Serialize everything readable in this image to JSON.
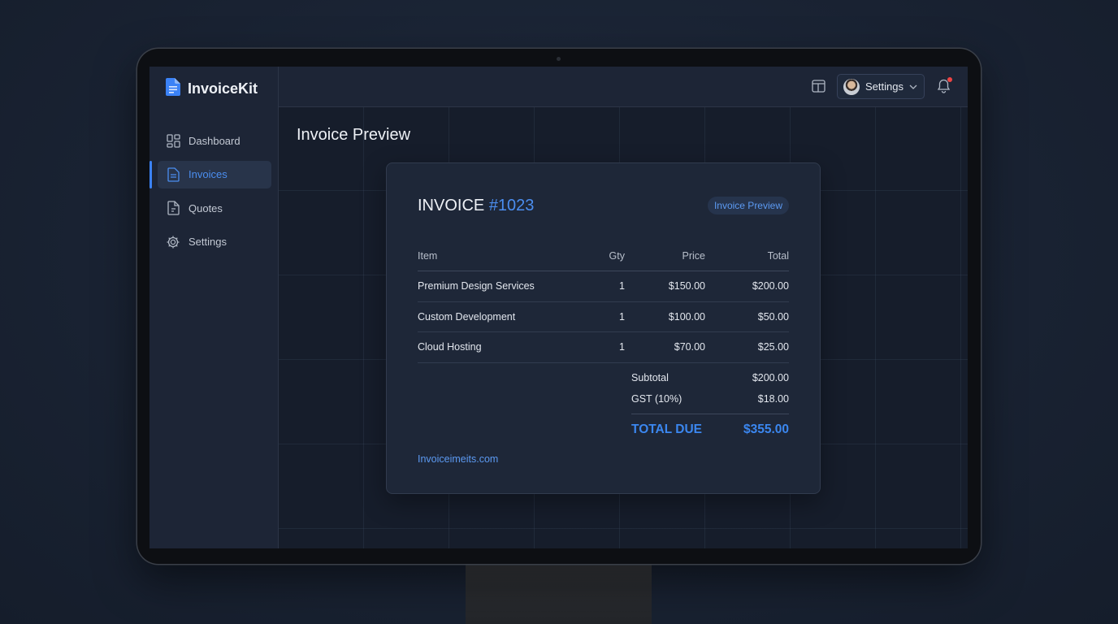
{
  "app": {
    "name": "InvoiceKit"
  },
  "sidebar": {
    "items": [
      {
        "label": "Dashboard",
        "icon": "dashboard-icon",
        "active": false
      },
      {
        "label": "Invoices",
        "icon": "document-icon",
        "active": true
      },
      {
        "label": "Quotes",
        "icon": "quote-document-icon",
        "active": false
      },
      {
        "label": "Settings",
        "icon": "gear-icon",
        "active": false
      }
    ]
  },
  "topbar": {
    "user_menu_label": "Settings"
  },
  "main": {
    "title": "Invoice Preview"
  },
  "invoice": {
    "title_prefix": "INVOICE",
    "number": "#1023",
    "badge": "Invoice Preview",
    "columns": {
      "item": "Item",
      "qty": "Gty",
      "price": "Price",
      "total": "Total"
    },
    "rows": [
      {
        "item": "Premium Design Services",
        "qty": "1",
        "price": "$150.00",
        "total": "$200.00"
      },
      {
        "item": "Custom Development",
        "qty": "1",
        "price": "$100.00",
        "total": "$50.00"
      },
      {
        "item": "Cloud Hosting",
        "qty": "1",
        "price": "$70.00",
        "total": "$25.00"
      }
    ],
    "subtotal_label": "Subtotal",
    "subtotal_value": "$200.00",
    "tax_label": "GST (10%)",
    "tax_value": "$18.00",
    "total_label": "TOTAL DUE",
    "total_value": "$355.00",
    "footer_link": "Invoiceimeits.com"
  },
  "colors": {
    "accent": "#3b82f6",
    "background": "#161d2b",
    "panel": "#1d2536",
    "notification": "#ef4444"
  }
}
